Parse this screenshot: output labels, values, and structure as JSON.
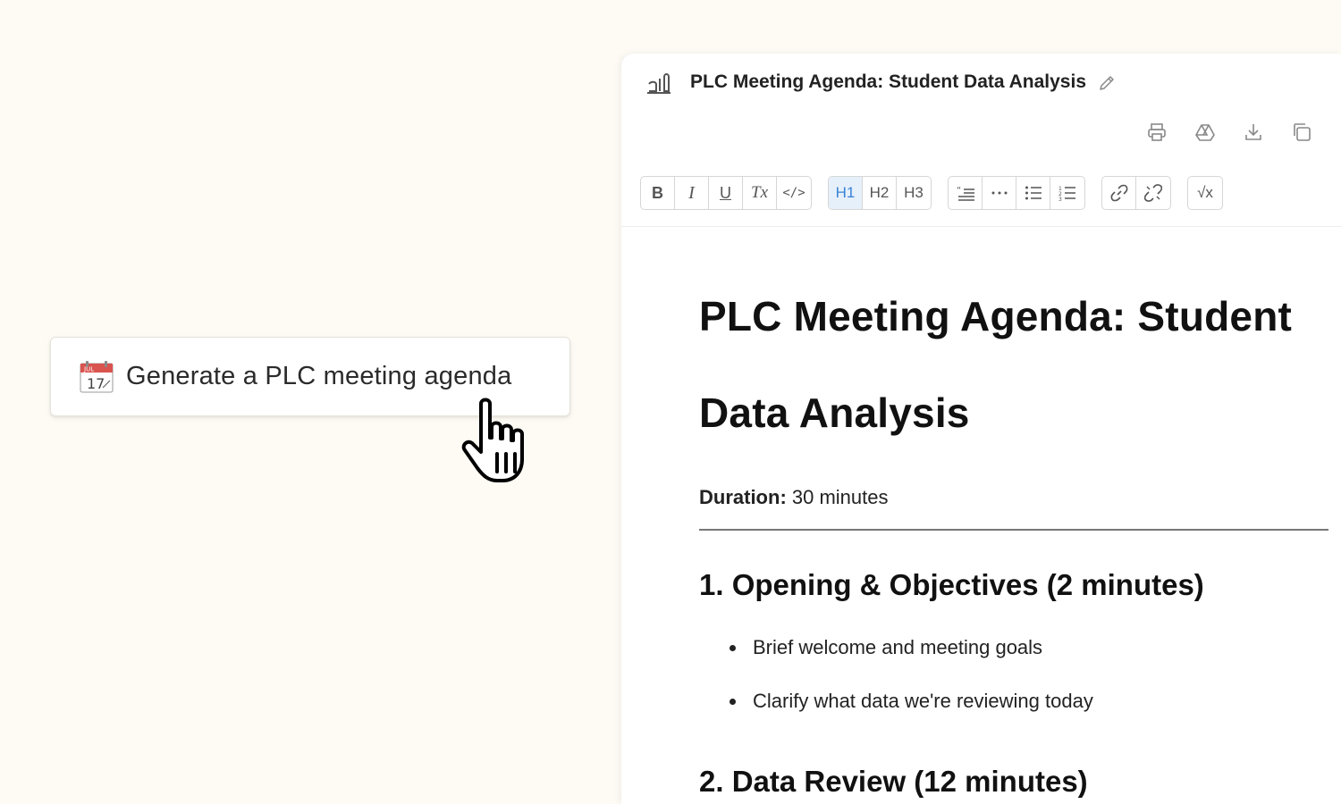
{
  "prompt": {
    "icon": "calendar-icon",
    "calendar_month": "JUL",
    "calendar_day": "17",
    "label": "Generate a PLC meeting agenda"
  },
  "document": {
    "title": "PLC Meeting Agenda: Student Data Analysis",
    "actions": [
      "print-icon",
      "drive-icon",
      "download-icon",
      "copy-icon"
    ],
    "toolbar": {
      "format": [
        "B",
        "I",
        "U",
        "Tx",
        "</>"
      ],
      "headings": [
        "H1",
        "H2",
        "H3"
      ],
      "active_heading": "H1",
      "blocks": [
        "quote-icon",
        "ellipsis-icon",
        "bullet-list-icon",
        "ordered-list-icon"
      ],
      "links": [
        "link-icon",
        "unlink-icon"
      ],
      "math": "√x"
    },
    "content": {
      "h1_line1": "PLC Meeting Agenda: Student",
      "h1_line2": "Data Analysis",
      "duration_label": "Duration:",
      "duration_value": " 30 minutes",
      "section1_title": "1. Opening & Objectives (2 minutes)",
      "section1_items": [
        "Brief welcome and meeting goals",
        "Clarify what data we're reviewing today"
      ],
      "section2_title": "2. Data Review (12 minutes)"
    }
  },
  "colors": {
    "page_background": "#fdfbf4",
    "active_tool": "#3a82d6",
    "active_tool_bg": "#e6f0fb"
  }
}
